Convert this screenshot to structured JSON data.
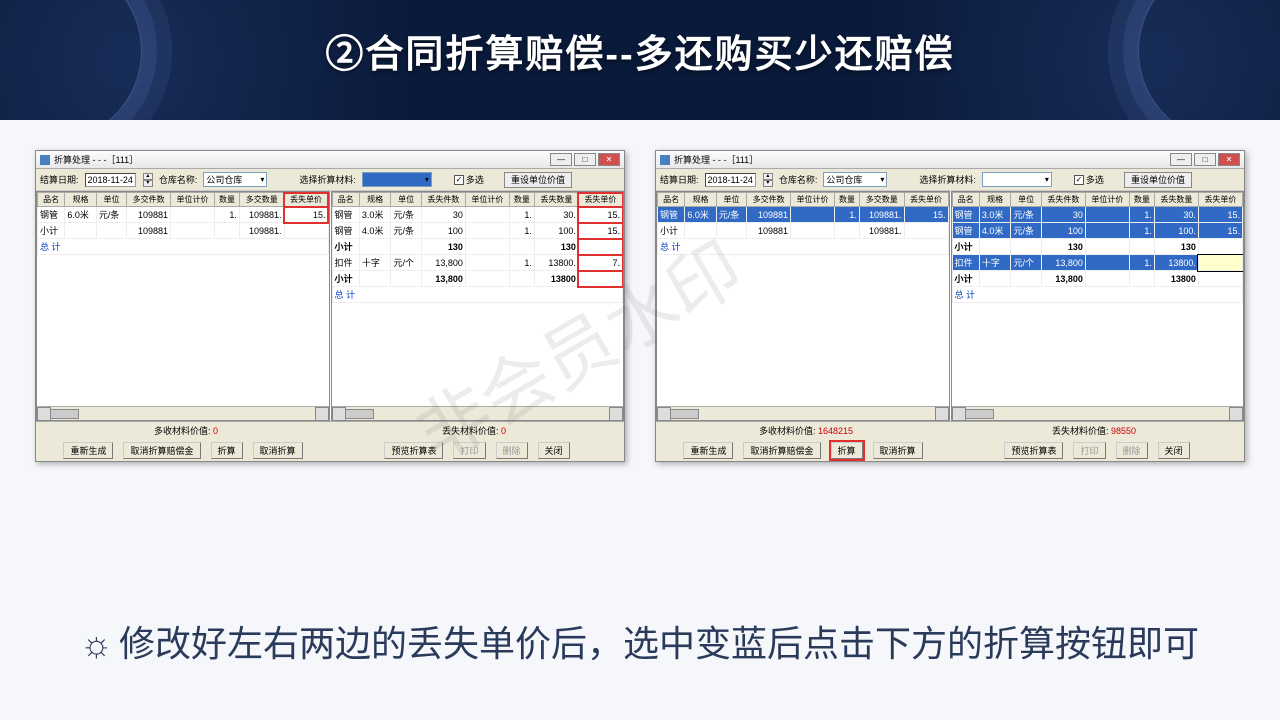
{
  "slide": {
    "title": "②合同折算赔偿--多还购买少还赔偿",
    "watermark": "非会员水印",
    "explanation_bullet": "☼",
    "explanation": "修改好左右两边的丢失单价后，选中变蓝后点击下方的折算按钮即可"
  },
  "window": {
    "title": "折算处理 - - -［111］",
    "btn_min": "—",
    "btn_max": "□",
    "btn_close": "✕",
    "toolbar": {
      "date_label": "结算日期:",
      "date_value": "2018-11-24",
      "warehouse_label": "仓库名称:",
      "warehouse_value": "公司仓库",
      "material_label": "选择折算材料:",
      "material_value": "",
      "multi_label": "多选",
      "reset_btn": "重设单位价值"
    },
    "columns_left": [
      "品名",
      "规格",
      "单位",
      "多交件数",
      "单位计价",
      "数量",
      "多交数量",
      "丢失单价"
    ],
    "columns_right": [
      "品名",
      "规格",
      "单位",
      "丢失件数",
      "单位计价",
      "数量",
      "丢失数量",
      "丢失单价"
    ],
    "left_a": {
      "rows": [
        {
          "c": [
            "钢管",
            "6.0米",
            "元/条",
            "109881",
            "",
            "1.",
            "109881.",
            "15."
          ]
        }
      ],
      "subtotal": [
        "小计",
        "",
        "",
        "109881",
        "",
        "",
        "109881.",
        ""
      ],
      "total": "总 计"
    },
    "right_a": {
      "rows": [
        {
          "c": [
            "钢管",
            "3.0米",
            "元/条",
            "30",
            "",
            "1.",
            "30.",
            "15."
          ]
        },
        {
          "c": [
            "钢管",
            "4.0米",
            "元/条",
            "100",
            "",
            "1.",
            "100.",
            "15."
          ]
        }
      ],
      "subtotal1": [
        "小计",
        "",
        "",
        "130",
        "",
        "",
        "130",
        ""
      ],
      "rows2": [
        {
          "c": [
            "扣件",
            "十字",
            "元/个",
            "13,800",
            "",
            "1.",
            "13800.",
            "7."
          ]
        }
      ],
      "subtotal2": [
        "小计",
        "",
        "",
        "13,800",
        "",
        "",
        "13800",
        ""
      ],
      "total": "总 计"
    },
    "left_b": {
      "rows": [
        {
          "c": [
            "钢管",
            "6.0米",
            "元/条",
            "109881",
            "",
            "1.",
            "109881.",
            "15."
          ]
        }
      ],
      "subtotal": [
        "小计",
        "",
        "",
        "109881",
        "",
        "",
        "109881.",
        ""
      ],
      "total": "总 计"
    },
    "right_b": {
      "rows": [
        {
          "c": [
            "钢管",
            "3.0米",
            "元/条",
            "30",
            "",
            "1.",
            "30.",
            "15."
          ]
        },
        {
          "c": [
            "钢管",
            "4.0米",
            "元/条",
            "100",
            "",
            "1.",
            "100.",
            "15."
          ]
        }
      ],
      "subtotal1": [
        "小计",
        "",
        "",
        "130",
        "",
        "",
        "130",
        ""
      ],
      "rows2": [
        {
          "c": [
            "扣件",
            "十字",
            "元/个",
            "13,800",
            "",
            "1.",
            "13800.",
            ""
          ]
        }
      ],
      "subtotal2": [
        "小计",
        "",
        "",
        "13,800",
        "",
        "",
        "13800",
        ""
      ],
      "total": "总 计"
    },
    "status": {
      "left_label": "多收材料价值:",
      "left_a": "0",
      "left_b": "1648215",
      "right_label": "丢失材料价值:",
      "right_a": "0",
      "right_b": "98550"
    },
    "buttons": {
      "regen": "重新生成",
      "cancel_comp": "取消折算赔偿金",
      "calc": "折算",
      "cancel_calc": "取消折算",
      "preview": "预览折算表",
      "print": "打印",
      "delete": "删除",
      "close": "关闭"
    }
  }
}
